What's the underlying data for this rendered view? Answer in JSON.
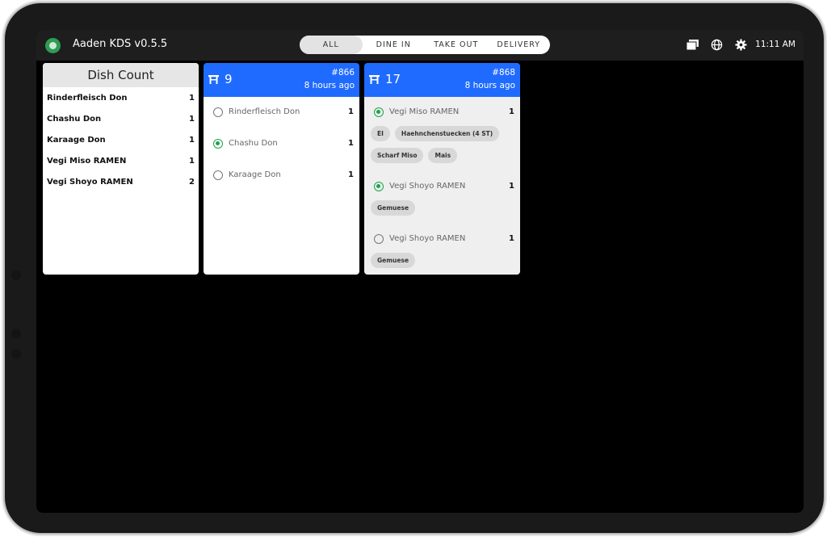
{
  "header": {
    "app_title": "Aaden KDS v0.5.5",
    "tabs": [
      {
        "label": "ALL",
        "active": true
      },
      {
        "label": "DINE IN",
        "active": false
      },
      {
        "label": "TAKE OUT",
        "active": false
      },
      {
        "label": "DELIVERY",
        "active": false
      }
    ],
    "clock": "11:11 AM",
    "icons": [
      "display-icon",
      "globe-icon",
      "gear-icon"
    ]
  },
  "dish_count": {
    "title": "Dish Count",
    "items": [
      {
        "name": "Rinderfleisch Don",
        "count": "1"
      },
      {
        "name": "Chashu Don",
        "count": "1"
      },
      {
        "name": "Karaage Don",
        "count": "1"
      },
      {
        "name": "Vegi Miso RAMEN",
        "count": "1"
      },
      {
        "name": "Vegi Shoyo RAMEN",
        "count": "2"
      }
    ]
  },
  "orders": [
    {
      "table": "9",
      "order_no": "#866",
      "time_ago": "8 hours ago",
      "items": [
        {
          "name": "Rinderfleisch Don",
          "qty": "1",
          "done": false,
          "mods": []
        },
        {
          "name": "Chashu Don",
          "qty": "1",
          "done": true,
          "mods": []
        },
        {
          "name": "Karaage Don",
          "qty": "1",
          "done": false,
          "mods": []
        }
      ]
    },
    {
      "table": "17",
      "order_no": "#868",
      "time_ago": "8 hours ago",
      "items": [
        {
          "name": "Vegi Miso RAMEN",
          "qty": "1",
          "done": true,
          "mods": [
            "EI",
            "Haehnchenstuecken (4 ST)",
            "Scharf Miso",
            "Mais"
          ]
        },
        {
          "name": "Vegi Shoyo RAMEN",
          "qty": "1",
          "done": true,
          "mods": [
            "Gemuese"
          ]
        },
        {
          "name": "Vegi Shoyo RAMEN",
          "qty": "1",
          "done": false,
          "mods": [
            "Gemuese"
          ]
        }
      ]
    }
  ],
  "colors": {
    "accent": "#1f6bff",
    "done": "#1da34b",
    "background": "#000000"
  }
}
